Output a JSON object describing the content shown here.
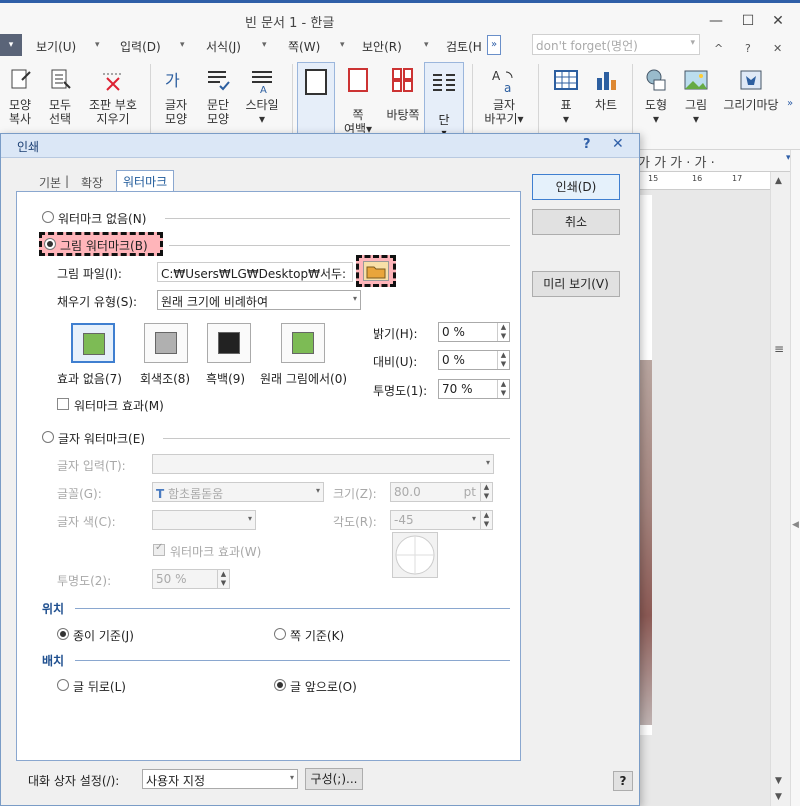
{
  "window": {
    "title": "빈 문서 1 - 한글",
    "min": "—",
    "max": "☐",
    "close": "✕"
  },
  "menubar": {
    "items": [
      "보기(U)",
      "입력(D)",
      "서식(J)",
      "쪽(W)",
      "보안(R)",
      "검토(H"
    ],
    "more": "»",
    "search_value": "don't forget(명언)",
    "right_icons": [
      "^",
      "?",
      "✕"
    ]
  },
  "ribbon": {
    "buttons": [
      {
        "label": "모양",
        "label2": "복사",
        "icon": "brush-icon"
      },
      {
        "label": "모두",
        "label2": "선택",
        "icon": "select-all-icon"
      },
      {
        "label": "조판 부호",
        "label2": "지우기",
        "icon": "clear-code-icon"
      },
      {
        "label": "글자",
        "label2": "모양",
        "icon": "char-shape-icon"
      },
      {
        "label": "문단",
        "label2": "모양",
        "icon": "para-shape-icon"
      },
      {
        "label": "스타일",
        "label2": "▾",
        "icon": "style-icon"
      },
      {
        "label": "쪽",
        "label2": "여백▾",
        "icon": "page-margin-icon"
      },
      {
        "label": "바탕쪽",
        "label2": "",
        "icon": "master-page-icon"
      },
      {
        "label": "단",
        "label2": "▾",
        "icon": "column-icon"
      },
      {
        "label": "글자",
        "label2": "바꾸기▾",
        "icon": "replace-icon"
      },
      {
        "label": "표",
        "label2": "▾",
        "icon": "table-icon"
      },
      {
        "label": "차트",
        "label2": "",
        "icon": "chart-icon"
      },
      {
        "label": "도형",
        "label2": "▾",
        "icon": "shape-icon"
      },
      {
        "label": "그림",
        "label2": "▾",
        "icon": "picture-icon"
      },
      {
        "label": "그리기마당",
        "label2": "",
        "icon": "drawing-icon"
      }
    ]
  },
  "formatbar": {
    "text": "가 가 가 · 가 ·"
  },
  "ruler": {
    "t1": "15",
    "t2": "16",
    "t3": "17"
  },
  "dialog": {
    "title": "인쇄",
    "help": "?",
    "close": "✕",
    "tabs": [
      "기본",
      "확장",
      "워터마크"
    ],
    "tab_sep": "|",
    "watermark": {
      "none_label": "워터마크 없음(N)",
      "picture_label": "그림 워터마크(B)",
      "file_label": "그림 파일(I):",
      "file_value": "C:₩Users₩LG₩Desktop₩서두:",
      "fill_label": "채우기 유형(S):",
      "fill_value": "원래 크기에 비례하여",
      "effects": [
        "효과 없음(7)",
        "회색조(8)",
        "흑백(9)",
        "원래 그림에서(0)"
      ],
      "bright_label": "밝기(H):",
      "bright_value": "0 %",
      "contrast_label": "대비(U):",
      "contrast_value": "0 %",
      "transparency_label": "투명도(1):",
      "transparency_value": "70 %",
      "wm_effect_label": "워터마크 효과(M)",
      "text_label": "글자 워터마크(E)",
      "text_input_label": "글자 입력(T):",
      "font_label": "글꼴(G):",
      "font_value": "함초롬돋움",
      "size_label": "크기(Z):",
      "size_value": "80.0",
      "size_unit": "pt",
      "color_label": "글자 색(C):",
      "angle_label": "각도(R):",
      "angle_value": "-45",
      "text_wm_effect_label": "워터마크 효과(W)",
      "text_trans_label": "투명도(2):",
      "text_trans_value": "50 %",
      "position_title": "위치",
      "pos_paper": "종이 기준(J)",
      "pos_page": "쪽 기준(K)",
      "layout_title": "배치",
      "behind": "글 뒤로(L)",
      "front": "글 앞으로(O)"
    },
    "buttons": {
      "print": "인쇄(D)",
      "cancel": "취소",
      "preview": "미리 보기(V)"
    },
    "footer": {
      "settings_label": "대화 상자 설정(/):",
      "settings_value": "사용자 지정",
      "config": "구성(;)...",
      "help": "?"
    }
  },
  "colors": {
    "accent": "#2f5fa8",
    "highlight": "#ff7884",
    "dialog_border": "#7a9cc6"
  }
}
